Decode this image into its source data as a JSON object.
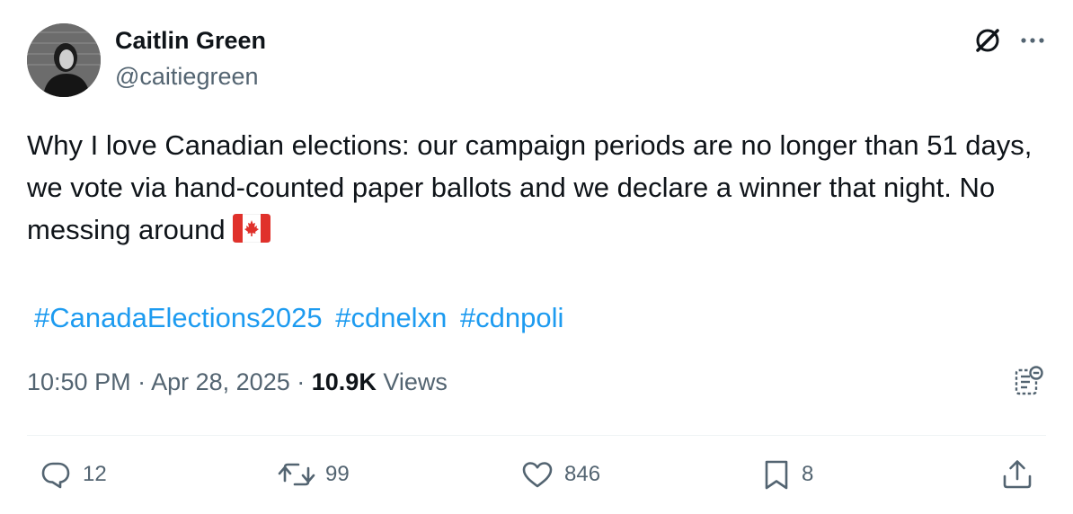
{
  "author": {
    "display_name": "Caitlin Green",
    "handle": "@caitiegreen"
  },
  "icons": {
    "grok": "grok-icon",
    "more": "more-options-icon",
    "analytics": "analytics-icon",
    "reply": "reply-icon",
    "repost": "repost-icon",
    "like": "heart-icon",
    "bookmark": "bookmark-icon",
    "share": "share-icon",
    "flag": "canada-flag-emoji"
  },
  "tweet": {
    "text": "Why I love Canadian elections: our campaign periods are no longer than 51 days, we vote via hand-counted paper ballots and we declare a winner that night. No messing around",
    "hashtags": [
      "#CanadaElections2025",
      "#cdnelxn",
      "#cdnpoli"
    ],
    "time": "10:50 PM",
    "separator": "·",
    "date": "Apr 28, 2025",
    "views_count": "10.9K",
    "views_label": "Views"
  },
  "actions": {
    "replies": "12",
    "reposts": "99",
    "likes": "846",
    "bookmarks": "8"
  },
  "colors": {
    "text": "#0f1419",
    "secondary": "#536471",
    "link": "#1d9bf0",
    "divider": "#eff3f4"
  }
}
